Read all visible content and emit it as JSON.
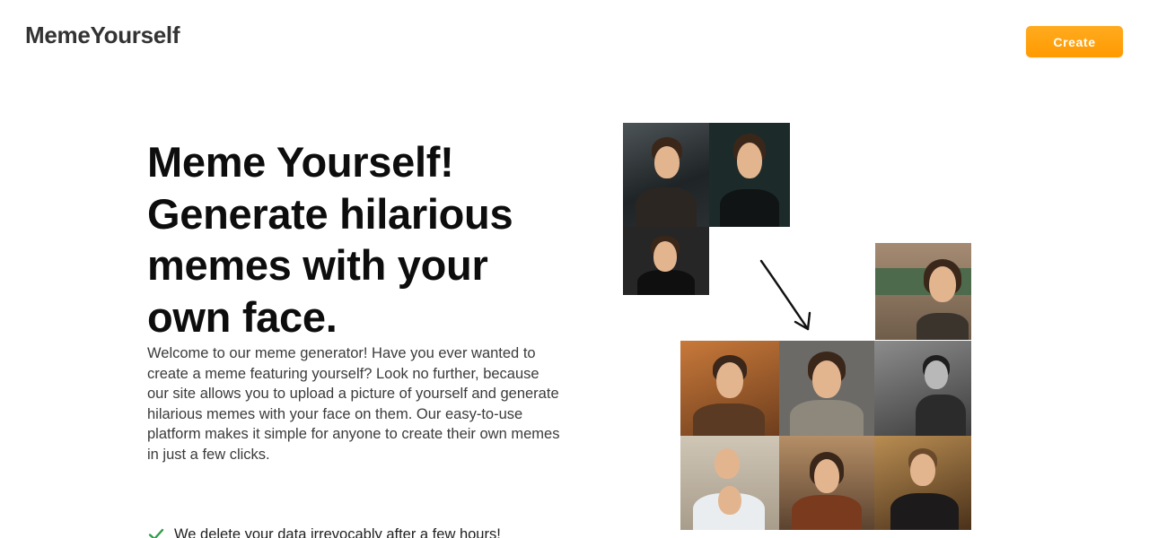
{
  "header": {
    "brand": "MemeYourself",
    "create_label": "Create"
  },
  "hero": {
    "title": "Meme Yourself! Generate hilarious memes with your own face.",
    "description": "Welcome to our meme generator! Have you ever wanted to create a meme featuring yourself? Look no further, because our site allows you to upload a picture of yourself and generate hilarious memes with your face on them. Our easy-to-use platform makes it simple for anyone to create their own memes in just a few clicks."
  },
  "features": [
    {
      "icon": "check-icon",
      "text": "We delete your data irrevocably after a few hours!"
    }
  ],
  "colors": {
    "accent": "#ff9f0a",
    "check": "#2e9d4a"
  }
}
